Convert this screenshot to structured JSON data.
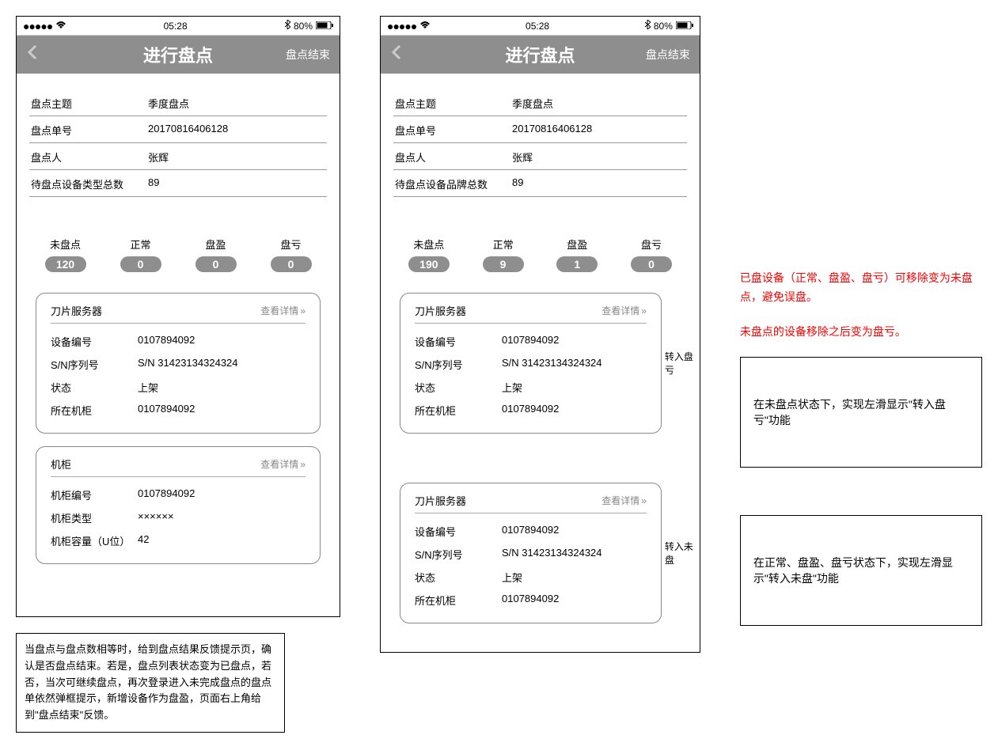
{
  "status": {
    "time": "05:28",
    "battery": "80%"
  },
  "header": {
    "title": "进行盘点",
    "right": "盘点结束"
  },
  "form_labels": {
    "topic": "盘点主题",
    "order": "盘点单号",
    "person": "盘点人",
    "total_type": "待盘点设备类型总数",
    "total_brand": "待盘点设备品牌总数"
  },
  "form_values": {
    "topic": "季度盘点",
    "order": "20170816406128",
    "person": "张辉",
    "total_left": "89",
    "total_right": "89"
  },
  "tab_labels": {
    "unpanned": "未盘点",
    "normal": "正常",
    "surplus": "盘盈",
    "loss": "盘亏"
  },
  "tabs_left": {
    "unpanned": "120",
    "normal": "0",
    "surplus": "0",
    "loss": "0"
  },
  "tabs_right": {
    "unpanned": "190",
    "normal": "9",
    "surplus": "1",
    "loss": "0"
  },
  "detail_link": "查看详情",
  "card1": {
    "title": "刀片服务器",
    "rows": {
      "device_no_l": "设备编号",
      "device_no_v": "0107894092",
      "sn_l": "S/N序列号",
      "sn_v": "S/N  31423134324324",
      "status_l": "状态",
      "status_v": "上架",
      "rack_l": "所在机柜",
      "rack_v": "0107894092"
    }
  },
  "card2": {
    "title": "机柜",
    "rows": {
      "rack_no_l": "机柜编号",
      "rack_no_v": "0107894092",
      "rack_type_l": "机柜类型",
      "rack_type_v": "××××××",
      "rack_cap_l": "机柜容量（U位）",
      "rack_cap_v": "42"
    }
  },
  "swipe1": "转入盘亏",
  "swipe2": "转入未盘",
  "red_notes": [
    "已盘设备（正常、盘盈、盘亏）可移除变为未盘点，避免误盘。",
    "未盘点的设备移除之后变为盘亏。"
  ],
  "side_box1": "在未盘点状态下，实现左滑显示\"转入盘亏\"功能",
  "side_box2": "在正常、盘盈、盘亏状态下，实现左滑显示\"转入未盘\"功能",
  "bottom_note": "当盘点与盘点数相等时，给到盘点结果反馈提示页，确认是否盘点结束。若是，盘点列表状态变为已盘点，若否，当次可继续盘点，再次登录进入未完成盘点的盘点单依然弹框提示，新增设备作为盘盈，页面右上角给到\"盘点结束\"反馈。"
}
